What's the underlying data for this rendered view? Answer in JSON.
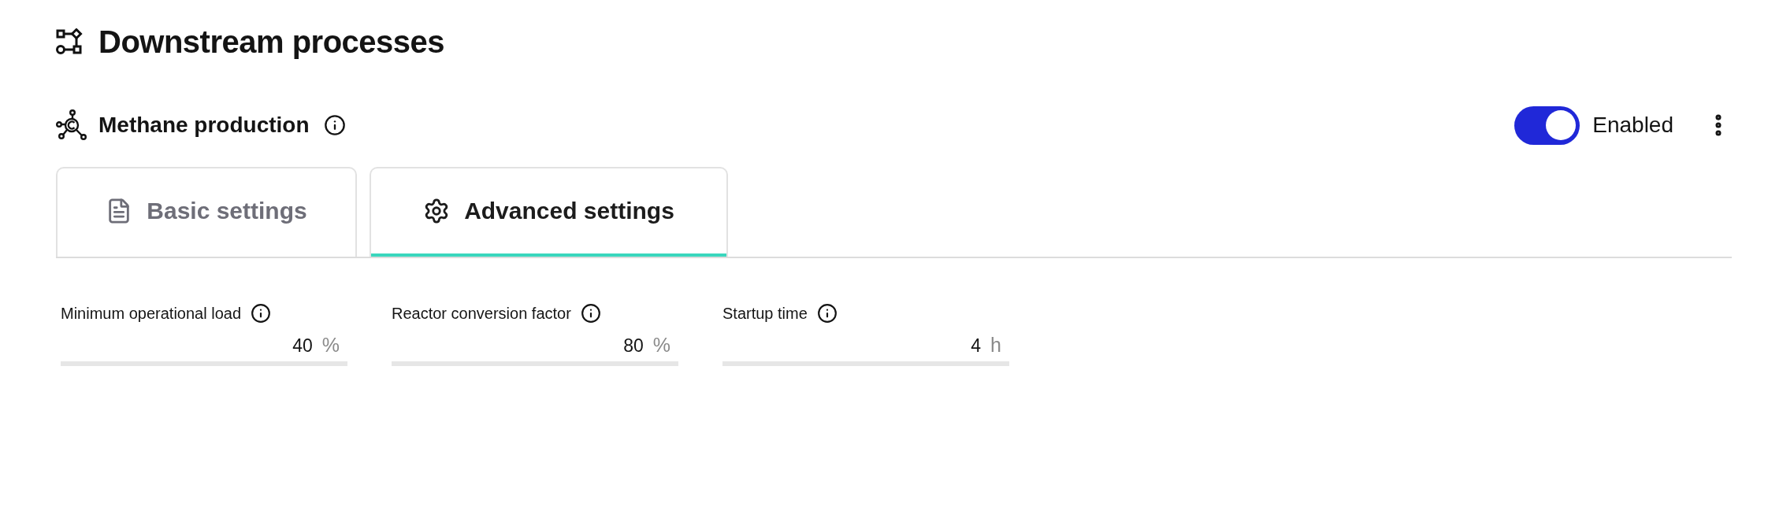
{
  "page": {
    "title": "Downstream processes"
  },
  "section": {
    "title": "Methane production",
    "toggle": {
      "on": true,
      "label": "Enabled"
    }
  },
  "tabs": [
    {
      "label": "Basic settings",
      "selected": false
    },
    {
      "label": "Advanced settings",
      "selected": true
    }
  ],
  "fields": [
    {
      "label": "Minimum operational load",
      "value": "40",
      "unit": "%"
    },
    {
      "label": "Reactor conversion factor",
      "value": "80",
      "unit": "%"
    },
    {
      "label": "Startup time",
      "value": "4",
      "unit": "h"
    }
  ]
}
